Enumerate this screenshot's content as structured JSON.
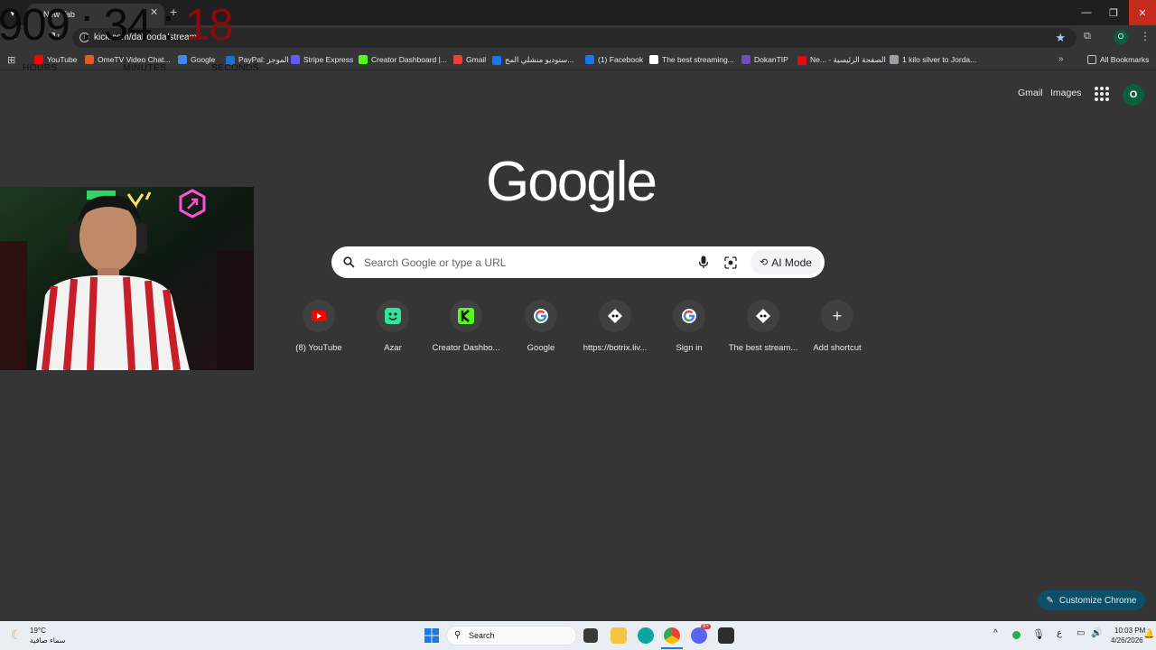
{
  "browser": {
    "tab_title": "New Tab",
    "url": "kick.com/dahooda/stream",
    "all_bookmarks_label": "All Bookmarks"
  },
  "timer": {
    "hours": "909",
    "minutes": "34",
    "seconds": "18",
    "sep": ":",
    "hours_label": "HOURS",
    "minutes_label": "MINUTES",
    "seconds_label": "SECONDS"
  },
  "bookmarks": [
    {
      "label": "YouTube",
      "icon": "youtube-icon",
      "color": "#ff0000"
    },
    {
      "label": "OmeTV Video Chat...",
      "icon": "ometv-icon",
      "color": "#e25b2a"
    },
    {
      "label": "Google",
      "icon": "google-icon",
      "color": "#4285f4"
    },
    {
      "label": "PayPal: الموجز",
      "icon": "paypal-icon",
      "color": "#1f6fd1"
    },
    {
      "label": "Stripe Express",
      "icon": "stripe-icon",
      "color": "#635bff"
    },
    {
      "label": "Creator Dashboard |...",
      "icon": "kick-icon",
      "color": "#53fc18"
    },
    {
      "label": "Gmail",
      "icon": "gmail-icon",
      "color": "#ea4335"
    },
    {
      "label": "ستوديو منشلي المح...",
      "icon": "meta-icon",
      "color": "#1877f2"
    },
    {
      "label": "(1) Facebook",
      "icon": "facebook-icon",
      "color": "#1877f2"
    },
    {
      "label": "The best streaming...",
      "icon": "botrix-icon",
      "color": "#ffffff"
    },
    {
      "label": "DokanTIP",
      "icon": "dokantip-icon",
      "color": "#6b4fbb"
    },
    {
      "label": "Ne... - الصفحة الرئيسية",
      "icon": "netflix-icon",
      "color": "#e50914"
    },
    {
      "label": "1 kilo silver to Jorda...",
      "icon": "globe-icon",
      "color": "#9aa0a6"
    }
  ],
  "ntp": {
    "gmail_link": "Gmail",
    "images_link": "Images",
    "profile_initial": "O",
    "logo_text": "Google",
    "search_placeholder": "Search Google or type a URL",
    "ai_mode_label": "AI Mode",
    "customize_label": "Customize Chrome",
    "shortcuts": [
      {
        "label": "(8) YouTube",
        "icon": "youtube-icon"
      },
      {
        "label": "Azar",
        "icon": "azar-icon"
      },
      {
        "label": "Creator Dashbo...",
        "icon": "kick-icon"
      },
      {
        "label": "Google",
        "icon": "google-icon"
      },
      {
        "label": "https://botrix.liv...",
        "icon": "botrix-icon"
      },
      {
        "label": "Sign in",
        "icon": "google-icon"
      },
      {
        "label": "The best stream...",
        "icon": "botrix-icon"
      },
      {
        "label": "Add shortcut",
        "icon": "plus-icon"
      }
    ]
  },
  "taskbar": {
    "temperature": "19°C",
    "weather_desc": "سماء صافية",
    "search_placeholder": "Search",
    "language": "ع",
    "time": "10:03 PM",
    "date": "4/26/2026",
    "discord_badge": "9+"
  },
  "colors": {
    "page_bg": "#353535",
    "accent_close": "#c42b1c",
    "timer_seconds": "#8b0b0b",
    "customize_bg": "#0b4f68"
  }
}
